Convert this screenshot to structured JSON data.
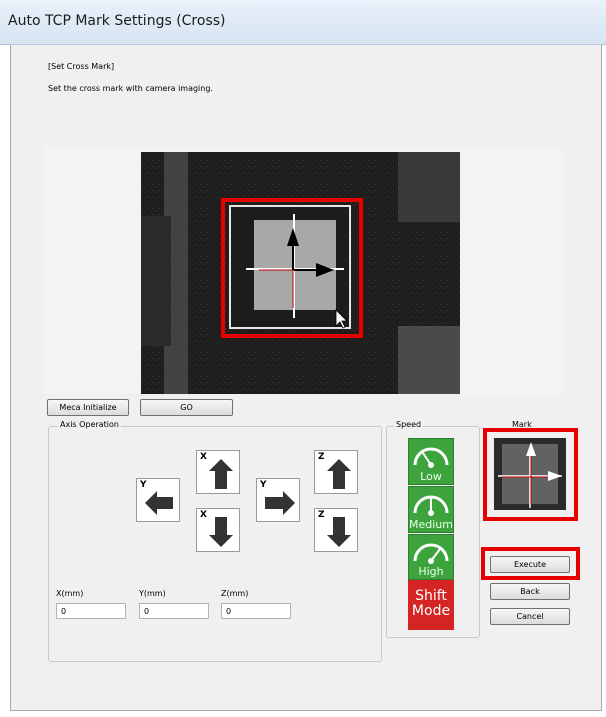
{
  "window": {
    "title": "Auto TCP Mark Settings (Cross)"
  },
  "header": {
    "section": "[Set Cross Mark]",
    "instruction": "Set the cross mark with camera imaging."
  },
  "toolbar": {
    "meca_initialize": "Meca Initialize",
    "go": "GO"
  },
  "axis_operation": {
    "label": "Axis Operation",
    "buttons": {
      "y_plus": "Y",
      "x_plus": "X",
      "x_minus": "X",
      "y_minus": "Y",
      "z_plus": "Z",
      "z_minus": "Z"
    },
    "fields": [
      {
        "label": "X(mm)",
        "value": "0"
      },
      {
        "label": "Y(mm)",
        "value": "0"
      },
      {
        "label": "Z(mm)",
        "value": "0"
      }
    ]
  },
  "speed": {
    "label": "Speed",
    "options": [
      "Low",
      "Medium",
      "High"
    ],
    "shift_mode_line1": "Shift",
    "shift_mode_line2": "Mode",
    "color_green": "#3da33d",
    "color_red": "#d52424"
  },
  "mark": {
    "label": "Mark"
  },
  "actions": {
    "execute": "Execute",
    "back": "Back",
    "cancel": "Cancel"
  },
  "highlight_color": "#e60000"
}
